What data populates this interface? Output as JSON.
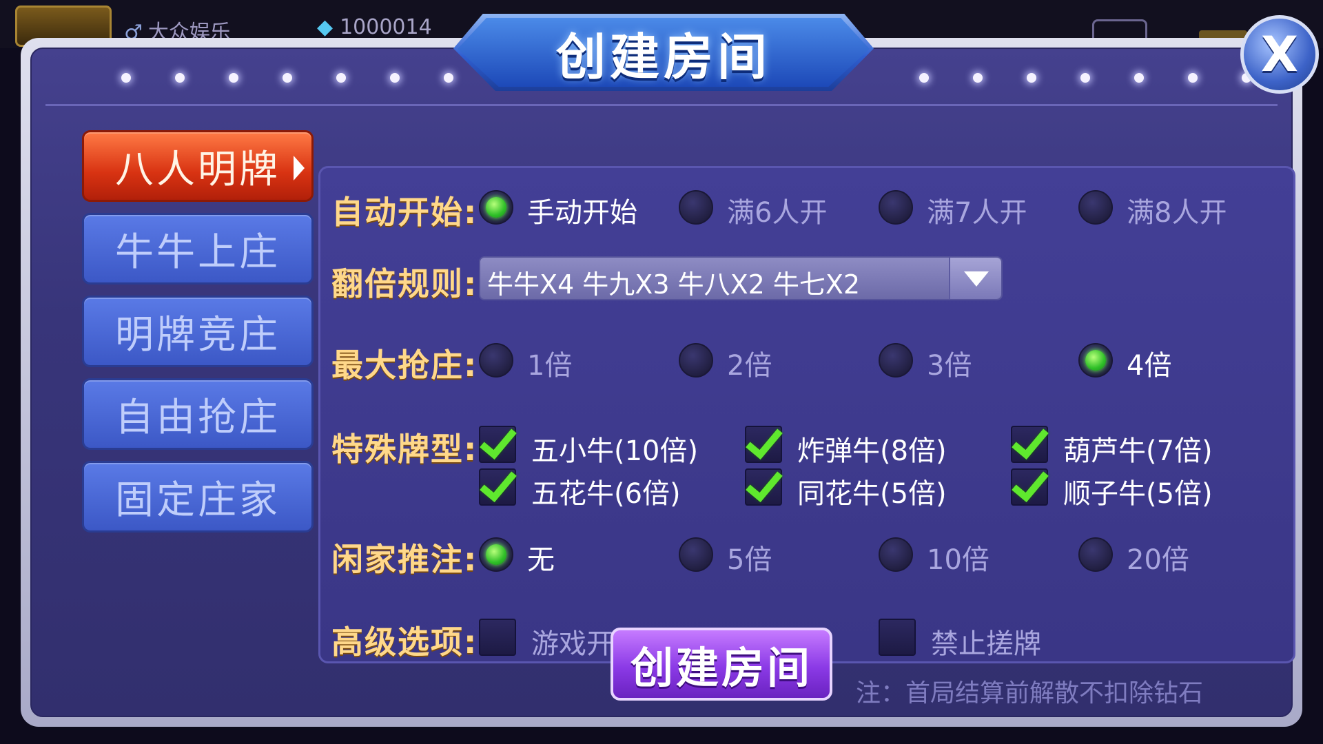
{
  "background": {
    "user_name": "大众娱乐",
    "diamond_count": "1000014"
  },
  "dialog": {
    "title": "创建房间",
    "close_label": "X"
  },
  "tabs": [
    {
      "label": "八人明牌",
      "active": true
    },
    {
      "label": "牛牛上庄",
      "active": false
    },
    {
      "label": "明牌竞庄",
      "active": false
    },
    {
      "label": "自由抢庄",
      "active": false
    },
    {
      "label": "固定庄家",
      "active": false
    }
  ],
  "settings": {
    "auto_start": {
      "label": "自动开始:",
      "options": [
        {
          "text": "手动开始",
          "selected": true
        },
        {
          "text": "满6人开",
          "selected": false
        },
        {
          "text": "满7人开",
          "selected": false
        },
        {
          "text": "满8人开",
          "selected": false
        }
      ]
    },
    "double_rule": {
      "label": "翻倍规则:",
      "value": "牛牛X4 牛九X3 牛八X2 牛七X2"
    },
    "max_banker": {
      "label": "最大抢庄:",
      "options": [
        {
          "text": "1倍",
          "selected": false
        },
        {
          "text": "2倍",
          "selected": false
        },
        {
          "text": "3倍",
          "selected": false
        },
        {
          "text": "4倍",
          "selected": true
        }
      ]
    },
    "special_cards": {
      "label": "特殊牌型:",
      "options": [
        {
          "text": "五小牛(10倍)",
          "checked": true
        },
        {
          "text": "炸弹牛(8倍)",
          "checked": true
        },
        {
          "text": "葫芦牛(7倍)",
          "checked": true
        },
        {
          "text": "五花牛(6倍)",
          "checked": true
        },
        {
          "text": "同花牛(5倍)",
          "checked": true
        },
        {
          "text": "顺子牛(5倍)",
          "checked": true
        }
      ]
    },
    "player_push": {
      "label": "闲家推注:",
      "options": [
        {
          "text": "无",
          "selected": true
        },
        {
          "text": "5倍",
          "selected": false
        },
        {
          "text": "10倍",
          "selected": false
        },
        {
          "text": "20倍",
          "selected": false
        }
      ]
    },
    "advanced": {
      "label": "高级选项:",
      "options": [
        {
          "text": "游戏开始后禁止加入",
          "checked": false
        },
        {
          "text": "禁止搓牌",
          "checked": false
        }
      ]
    }
  },
  "create_button_label": "创建房间",
  "note": "注：首局结算前解散不扣除钻石",
  "colors": {
    "accent_active_tab": "#d83312",
    "tab_blue": "#4a68d6",
    "label_gold": "#ffd88a",
    "radio_on_green": "#2fbf28",
    "check_green": "#5fe82e",
    "create_button_purple": "#8b3ae6"
  }
}
